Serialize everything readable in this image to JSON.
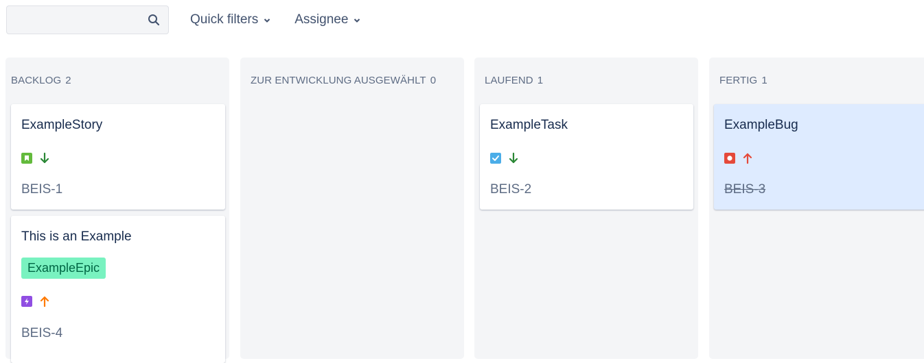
{
  "toolbar": {
    "search_value": "",
    "search_placeholder": "",
    "quick_filters_label": "Quick filters",
    "assignee_label": "Assignee"
  },
  "columns": [
    {
      "name": "BACKLOG",
      "count": "2"
    },
    {
      "name": "ZUR ENTWICKLUNG AUSGEWÄHLT",
      "count": "0"
    },
    {
      "name": "LAUFEND",
      "count": "1"
    },
    {
      "name": "FERTIG",
      "count": "1"
    }
  ],
  "cards": [
    {
      "title": "ExampleStory",
      "key": "BEIS-1",
      "type": "story-icon",
      "priority": "low-priority-arrow-down-icon",
      "type_color": "#63ba3c",
      "priority_color": "#2a8735"
    },
    {
      "title": "This is an Example",
      "epic": "ExampleEpic",
      "key": "BEIS-4",
      "type": "epic-icon",
      "priority": "high-priority-arrow-up-icon",
      "type_color": "#904ee2",
      "priority_color": "#ff7a00"
    },
    {
      "title": "ExampleTask",
      "key": "BEIS-2",
      "type": "task-icon",
      "priority": "low-priority-arrow-down-icon",
      "type_color": "#4bade8",
      "priority_color": "#2a8735"
    },
    {
      "title": "ExampleBug",
      "key": "BEIS-3",
      "type": "bug-icon",
      "priority": "highest-priority-arrow-up-icon",
      "type_color": "#e5493a",
      "priority_color": "#e5493a",
      "done": true
    }
  ],
  "colors": {
    "column_bg": "#f4f5f7",
    "selected_card_bg": "#deebff",
    "epic_bg": "#79f2c0",
    "epic_text": "#006644"
  }
}
